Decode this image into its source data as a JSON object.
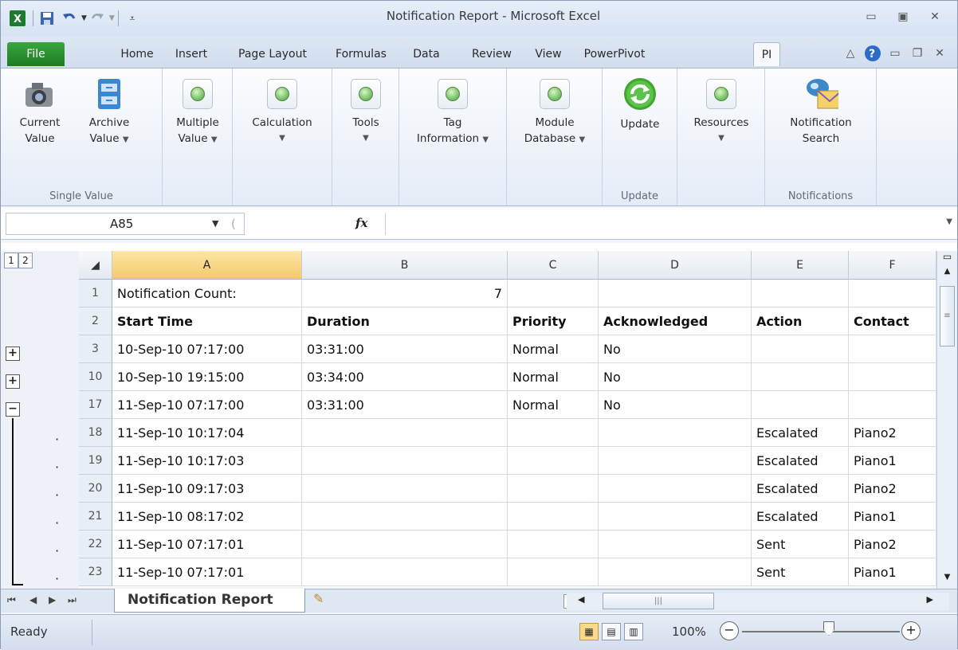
{
  "window": {
    "title": "Notification Report - Microsoft Excel"
  },
  "qat": {
    "icons": [
      "excel-icon",
      "save-icon",
      "undo-icon",
      "redo-icon",
      "customize-qat-icon"
    ]
  },
  "tabs": [
    "File",
    "Home",
    "Insert",
    "Page Layout",
    "Formulas",
    "Data",
    "Review",
    "View",
    "PowerPivot",
    "PI"
  ],
  "ribbon": {
    "groups": [
      {
        "label": "Single Value",
        "buttons": [
          {
            "label": "Current\nValue"
          },
          {
            "label": "Archive\nValue"
          }
        ]
      },
      {
        "buttons": [
          {
            "label": "Multiple\nValue"
          }
        ]
      },
      {
        "buttons": [
          {
            "label": "Calculation"
          }
        ]
      },
      {
        "buttons": [
          {
            "label": "Tools"
          }
        ]
      },
      {
        "buttons": [
          {
            "label": "Tag\nInformation"
          }
        ]
      },
      {
        "buttons": [
          {
            "label": "Module\nDatabase"
          }
        ]
      },
      {
        "label": "Update",
        "buttons": [
          {
            "label": "Update"
          }
        ]
      },
      {
        "buttons": [
          {
            "label": "Resources"
          }
        ]
      },
      {
        "label": "Notifications",
        "buttons": [
          {
            "label": "Notification\nSearch"
          }
        ]
      }
    ],
    "current_value": "Current",
    "current_value2": "Value",
    "archive_value": "Archive",
    "archive_value2": "Value",
    "multiple_value": "Multiple",
    "multiple_value2": "Value",
    "calculation": "Calculation",
    "tools": "Tools",
    "tag_info": "Tag",
    "tag_info2": "Information",
    "module_db": "Module",
    "module_db2": "Database",
    "update": "Update",
    "resources": "Resources",
    "notif_search": "Notification",
    "notif_search2": "Search",
    "group_single": "Single Value",
    "group_update": "Update",
    "group_notifications": "Notifications"
  },
  "formula_bar": {
    "name_box": "A85",
    "fx": "fx",
    "formula": ""
  },
  "columns": [
    "A",
    "B",
    "C",
    "D",
    "E",
    "F"
  ],
  "outline_levels": [
    "1",
    "2"
  ],
  "rows": [
    {
      "num": "1",
      "A": "Notification Count:",
      "B": "7",
      "C": "",
      "D": "",
      "E": "",
      "F": ""
    },
    {
      "num": "2",
      "A": "Start Time",
      "B": "Duration",
      "C": "Priority",
      "D": "Acknowledged",
      "E": "Action",
      "F": "Contact"
    },
    {
      "num": "3",
      "A": "10-Sep-10 07:17:00",
      "B": "03:31:00",
      "C": "Normal",
      "D": "No",
      "E": "",
      "F": ""
    },
    {
      "num": "10",
      "A": "10-Sep-10 19:15:00",
      "B": "03:34:00",
      "C": "Normal",
      "D": "No",
      "E": "",
      "F": ""
    },
    {
      "num": "17",
      "A": "11-Sep-10 07:17:00",
      "B": "03:31:00",
      "C": "Normal",
      "D": "No",
      "E": "",
      "F": ""
    },
    {
      "num": "18",
      "A": "11-Sep-10 10:17:04",
      "B": "",
      "C": "",
      "D": "",
      "E": "Escalated",
      "F": "Piano2"
    },
    {
      "num": "19",
      "A": "11-Sep-10 10:17:03",
      "B": "",
      "C": "",
      "D": "",
      "E": "Escalated",
      "F": "Piano1"
    },
    {
      "num": "20",
      "A": "11-Sep-10 09:17:03",
      "B": "",
      "C": "",
      "D": "",
      "E": "Escalated",
      "F": "Piano2"
    },
    {
      "num": "21",
      "A": "11-Sep-10 08:17:02",
      "B": "",
      "C": "",
      "D": "",
      "E": "Escalated",
      "F": "Piano1"
    },
    {
      "num": "22",
      "A": "11-Sep-10 07:17:01",
      "B": "",
      "C": "",
      "D": "",
      "E": "Sent",
      "F": "Piano2"
    },
    {
      "num": "23",
      "A": "11-Sep-10 07:17:01",
      "B": "",
      "C": "",
      "D": "",
      "E": "Sent",
      "F": "Piano1"
    }
  ],
  "sheet_tab": "Notification Report",
  "status": {
    "ready": "Ready",
    "zoom": "100%"
  },
  "colors": {
    "file_tab": "#2a8f2f",
    "selected_header": "#f5c96a",
    "ribbon_bg": "#e5ecf6"
  }
}
